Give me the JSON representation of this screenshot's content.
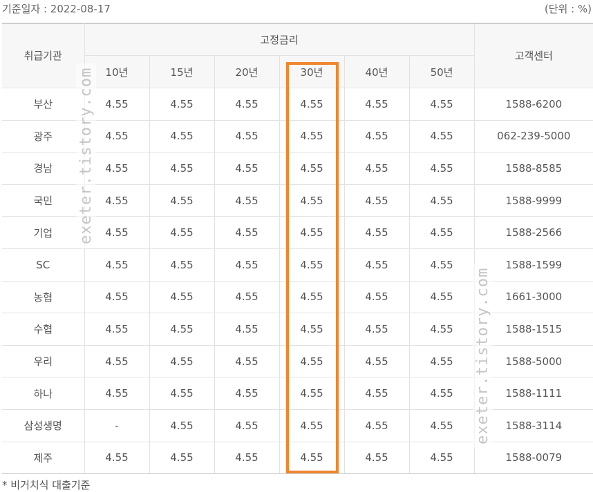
{
  "header": {
    "base_date": "기준일자 : 2022-08-17",
    "unit": "(단위 : %)"
  },
  "table": {
    "institution_header": "취급기관",
    "fixed_rate_header": "고정금리",
    "center_header": "고객센터",
    "terms": [
      "10년",
      "15년",
      "20년",
      "30년",
      "40년",
      "50년"
    ],
    "rows": [
      {
        "bank": "부산",
        "rates": [
          "4.55",
          "4.55",
          "4.55",
          "4.55",
          "4.55",
          "4.55"
        ],
        "phone": "1588-6200"
      },
      {
        "bank": "광주",
        "rates": [
          "4.55",
          "4.55",
          "4.55",
          "4.55",
          "4.55",
          "4.55"
        ],
        "phone": "062-239-5000"
      },
      {
        "bank": "경남",
        "rates": [
          "4.55",
          "4.55",
          "4.55",
          "4.55",
          "4.55",
          "4.55"
        ],
        "phone": "1588-8585"
      },
      {
        "bank": "국민",
        "rates": [
          "4.55",
          "4.55",
          "4.55",
          "4.55",
          "4.55",
          "4.55"
        ],
        "phone": "1588-9999"
      },
      {
        "bank": "기업",
        "rates": [
          "4.55",
          "4.55",
          "4.55",
          "4.55",
          "4.55",
          "4.55"
        ],
        "phone": "1588-2566"
      },
      {
        "bank": "SC",
        "rates": [
          "4.55",
          "4.55",
          "4.55",
          "4.55",
          "4.55",
          "4.55"
        ],
        "phone": "1588-1599"
      },
      {
        "bank": "농협",
        "rates": [
          "4.55",
          "4.55",
          "4.55",
          "4.55",
          "4.55",
          "4.55"
        ],
        "phone": "1661-3000"
      },
      {
        "bank": "수협",
        "rates": [
          "4.55",
          "4.55",
          "4.55",
          "4.55",
          "4.55",
          "4.55"
        ],
        "phone": "1588-1515"
      },
      {
        "bank": "우리",
        "rates": [
          "4.55",
          "4.55",
          "4.55",
          "4.55",
          "4.55",
          "4.55"
        ],
        "phone": "1588-5000"
      },
      {
        "bank": "하나",
        "rates": [
          "4.55",
          "4.55",
          "4.55",
          "4.55",
          "4.55",
          "4.55"
        ],
        "phone": "1588-1111"
      },
      {
        "bank": "삼성생명",
        "rates": [
          "-",
          "4.55",
          "4.55",
          "4.55",
          "4.55",
          "4.55"
        ],
        "phone": "1588-3114"
      },
      {
        "bank": "제주",
        "rates": [
          "4.55",
          "4.55",
          "4.55",
          "4.55",
          "4.55",
          "4.55"
        ],
        "phone": "1588-0079"
      }
    ]
  },
  "highlight": {
    "column": "30년",
    "color": "#f0862f"
  },
  "watermark": {
    "text": "exeter.tistory.com"
  },
  "footnote": "* 비거치식 대출기준"
}
